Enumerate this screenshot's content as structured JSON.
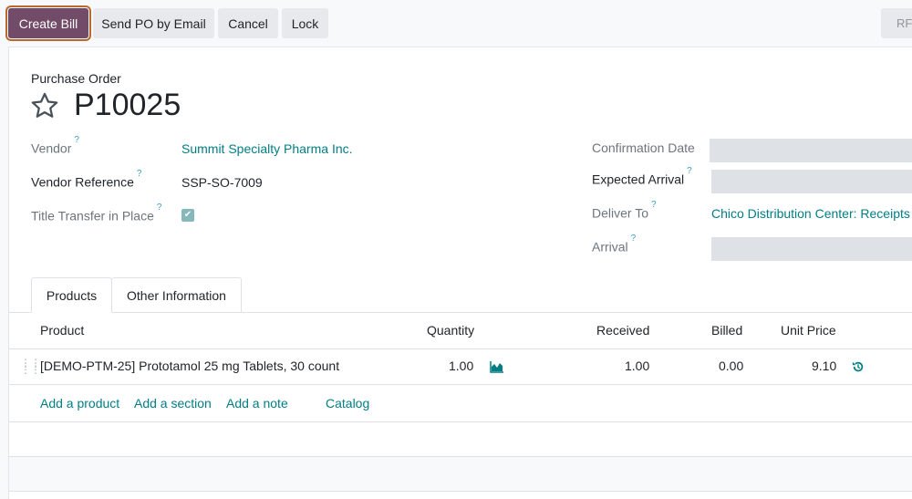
{
  "toolbar": {
    "create_bill": "Create Bill",
    "send_po": "Send PO by Email",
    "cancel": "Cancel",
    "lock": "Lock",
    "rfq_status": "RF"
  },
  "form": {
    "doc_type": "Purchase Order",
    "doc_name": "P10025",
    "vendor_label": "Vendor",
    "vendor_value": "Summit Specialty Pharma Inc.",
    "vendor_ref_label": "Vendor Reference",
    "vendor_ref_value": "SSP-SO-7009",
    "title_transfer_label": "Title Transfer in Place",
    "title_transfer_checked": true,
    "confirmation_date_label": "Confirmation Date",
    "expected_arrival_label": "Expected Arrival",
    "deliver_to_label": "Deliver To",
    "deliver_to_value": "Chico Distribution Center: Receipts",
    "arrival_label": "Arrival",
    "help_mark": "?"
  },
  "tabs": [
    {
      "label": "Products",
      "active": true
    },
    {
      "label": "Other Information",
      "active": false
    }
  ],
  "table": {
    "columns": [
      "Product",
      "Quantity",
      "Received",
      "Billed",
      "Unit Price"
    ],
    "rows": [
      {
        "product": "[DEMO-PTM-25] Prototamol 25 mg Tablets, 30 count",
        "quantity": "1.00",
        "received": "1.00",
        "billed": "0.00",
        "unit_price": "9.10"
      }
    ],
    "actions": {
      "add_product": "Add a product",
      "add_section": "Add a section",
      "add_note": "Add a note",
      "catalog": "Catalog"
    }
  },
  "colors": {
    "primary": "#714b67",
    "link": "#017e84",
    "focus_outline": "#b86a2e"
  }
}
